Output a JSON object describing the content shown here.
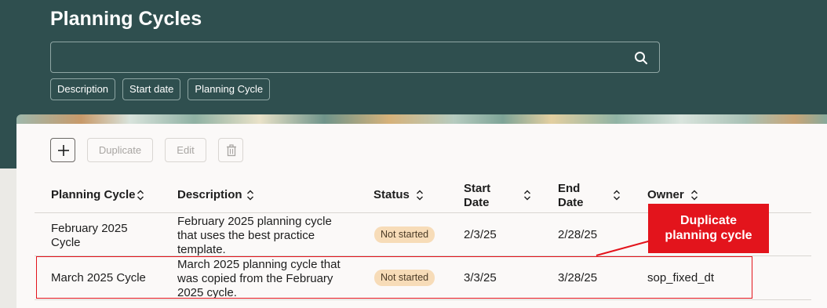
{
  "header": {
    "title": "Planning Cycles",
    "search_value": "",
    "filter_chips": [
      "Description",
      "Start date",
      "Planning Cycle"
    ]
  },
  "toolbar": {
    "add_icon": "plus-icon",
    "duplicate_label": "Duplicate",
    "edit_label": "Edit",
    "delete_icon": "trash-icon"
  },
  "table": {
    "columns": [
      {
        "line1": "Planning Cycle",
        "line2": ""
      },
      {
        "line1": "Description",
        "line2": ""
      },
      {
        "line1": "Status",
        "line2": ""
      },
      {
        "line1": "Start",
        "line2": "Date"
      },
      {
        "line1": "End",
        "line2": "Date"
      },
      {
        "line1": "Owner",
        "line2": ""
      }
    ],
    "rows": [
      {
        "cycle": [
          "February 2025",
          "Cycle"
        ],
        "description": [
          "February 2025 planning cycle",
          "that uses the best practice",
          "template."
        ],
        "status": "Not started",
        "start": "2/3/25",
        "end": "2/28/25",
        "owner": ""
      },
      {
        "cycle": [
          "March 2025 Cycle"
        ],
        "description": [
          "March 2025 planning cycle that",
          "was copied from the February",
          "2025 cycle."
        ],
        "status": "Not started",
        "start": "3/3/25",
        "end": "3/28/25",
        "owner": "sop_fixed_dt"
      }
    ]
  },
  "annotation": {
    "callout_lines": [
      "Duplicate",
      "planning cycle"
    ]
  },
  "colors": {
    "header_bg": "#2f4f4f",
    "status_badge": "#f7dcb8",
    "annotation_red": "#e3141c"
  }
}
